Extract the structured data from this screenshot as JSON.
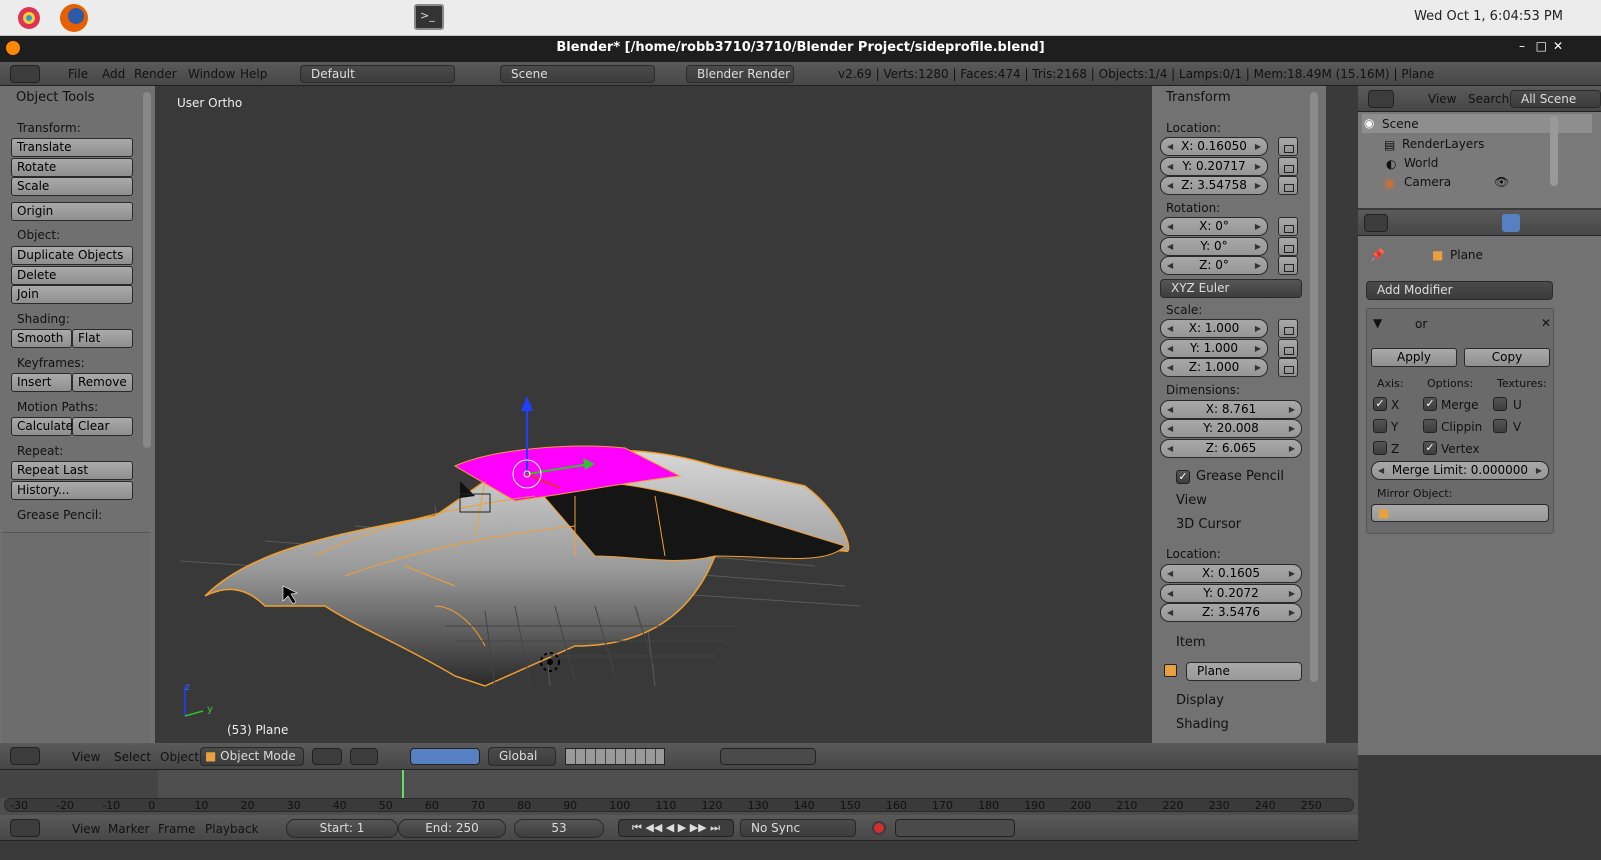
{
  "os": {
    "clock": "Wed Oct  1,  6:04:53 PM"
  },
  "window": {
    "title": "Blender* [/home/robb3710/3710/Blender Project/sideprofile.blend]",
    "controls": [
      "–",
      "□",
      "✕"
    ]
  },
  "info_header": {
    "menus": [
      "File",
      "Add",
      "Render",
      "Window",
      "Help"
    ],
    "layout": "Default",
    "scene": "Scene",
    "engine": "Blender Render",
    "stats": "v2.69 | Verts:1280 | Faces:474 | Tris:2168 | Objects:1/4 | Lamps:0/1 | Mem:18.49M (15.16M) | Plane"
  },
  "tools": {
    "title": "Object Tools",
    "transform_label": "Transform:",
    "translate": "Translate",
    "rotate": "Rotate",
    "scale": "Scale",
    "origin": "Origin",
    "object_label": "Object:",
    "duplicate": "Duplicate Objects",
    "delete": "Delete",
    "join": "Join",
    "shading_label": "Shading:",
    "smooth": "Smooth",
    "flat": "Flat",
    "keyframes_label": "Keyframes:",
    "insert": "Insert",
    "remove": "Remove",
    "motion_label": "Motion Paths:",
    "calculate": "Calculate",
    "clear": "Clear",
    "repeat_label": "Repeat:",
    "repeat_last": "Repeat Last",
    "history": "History...",
    "grease_label": "Grease Pencil:"
  },
  "viewport": {
    "view_name": "User Ortho",
    "object_label": "(53) Plane",
    "axis_z": "z",
    "axis_y": "y"
  },
  "properties": {
    "transform_title": "Transform",
    "location_label": "Location:",
    "loc_x": "X: 0.16050",
    "loc_y": "Y: 0.20717",
    "loc_z": "Z: 3.54758",
    "rotation_label": "Rotation:",
    "rot_x": "X: 0°",
    "rot_y": "Y: 0°",
    "rot_z": "Z: 0°",
    "rot_mode": "XYZ Euler",
    "scale_label": "Scale:",
    "scale_x": "X: 1.000",
    "scale_y": "Y: 1.000",
    "scale_z": "Z: 1.000",
    "dims_label": "Dimensions:",
    "dim_x": "X: 8.761",
    "dim_y": "Y: 20.008",
    "dim_z": "Z: 6.065",
    "grease_pencil": "Grease Pencil",
    "view": "View",
    "cursor_title": "3D Cursor",
    "cursor_loc_label": "Location:",
    "cur_x": "X: 0.1605",
    "cur_y": "Y: 0.2072",
    "cur_z": "Z: 3.5476",
    "item_title": "Item",
    "item_name": "Plane",
    "display": "Display",
    "shading": "Shading"
  },
  "outliner": {
    "view": "View",
    "search": "Search",
    "filter": "All Scene",
    "rows": [
      "Scene",
      "RenderLayers",
      "World",
      "Camera"
    ]
  },
  "modifiers": {
    "object": "Plane",
    "add_modifier": "Add Modifier",
    "name_stub": "or",
    "apply": "Apply",
    "copy": "Copy",
    "axis_label": "Axis:",
    "options_label": "Options:",
    "textures_label": "Textures:",
    "x": "X",
    "y": "Y",
    "z": "Z",
    "merge": "Merge",
    "clipping": "Clippin",
    "vertex": "Vertex",
    "u": "U",
    "v": "V",
    "merge_limit": "Merge Limit: 0.000000",
    "mirror_object": "Mirror Object:"
  },
  "view3d_header": {
    "view": "View",
    "select": "Select",
    "object": "Object",
    "mode": "Object Mode",
    "orientation": "Global"
  },
  "timeline": {
    "ticks": [
      "-30",
      "-20",
      "-10",
      "0",
      "10",
      "20",
      "30",
      "40",
      "50",
      "60",
      "70",
      "80",
      "90",
      "100",
      "110",
      "120",
      "130",
      "140",
      "150",
      "160",
      "170",
      "180",
      "190",
      "200",
      "210",
      "220",
      "230",
      "240",
      "250"
    ],
    "view": "View",
    "marker": "Marker",
    "frame": "Frame",
    "playback": "Playback",
    "start": "Start: 1",
    "end": "End: 250",
    "current": "53",
    "sync": "No Sync"
  },
  "colors": {
    "selection": "#f0a030",
    "active_face": "#ff00ff",
    "accent": "#5680c2"
  }
}
